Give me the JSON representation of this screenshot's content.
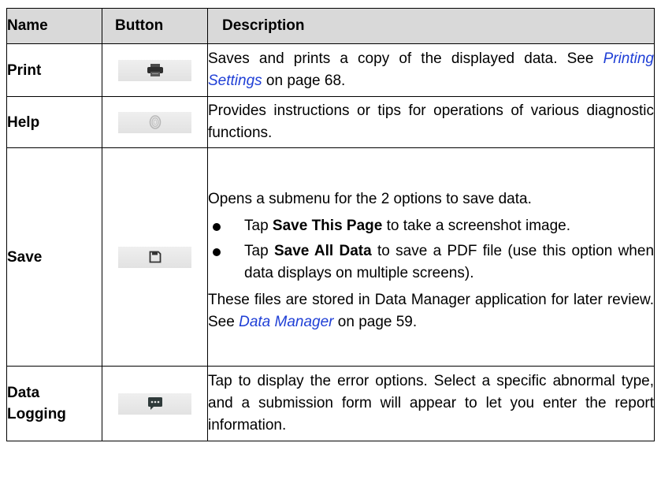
{
  "header": {
    "name": "Name",
    "button": "Button",
    "description": "Description"
  },
  "rows": [
    {
      "name": "Print",
      "icon": "printer-icon",
      "desc_pre": "Saves and prints a copy of the displayed data. See ",
      "link": "Printing Settings",
      "desc_post": " on page 68."
    },
    {
      "name": "Help",
      "icon": "help-fingerprint-icon",
      "desc": "Provides instructions or tips for operations of various diagnostic functions."
    },
    {
      "name": "Save",
      "icon": "floppy-disk-icon",
      "intro": "Opens a submenu for the 2 options to save data.",
      "options": [
        {
          "pre": "Tap ",
          "bold": "Save This Page",
          "post": " to take a screenshot image."
        },
        {
          "pre": "Tap ",
          "bold": "Save All Data",
          "post": " to save a PDF file (use this option when data displays on multiple screens)."
        }
      ],
      "note_pre": "These files are stored in Data Manager application for later review. See ",
      "link": "Data Manager",
      "note_post": " on page 59."
    },
    {
      "name_line1": "Data",
      "name_line2": "Logging",
      "icon": "chat-message-icon",
      "desc": "Tap to display the error options. Select a specific abnormal type, and a submission form will appear to let you enter the report information."
    }
  ]
}
